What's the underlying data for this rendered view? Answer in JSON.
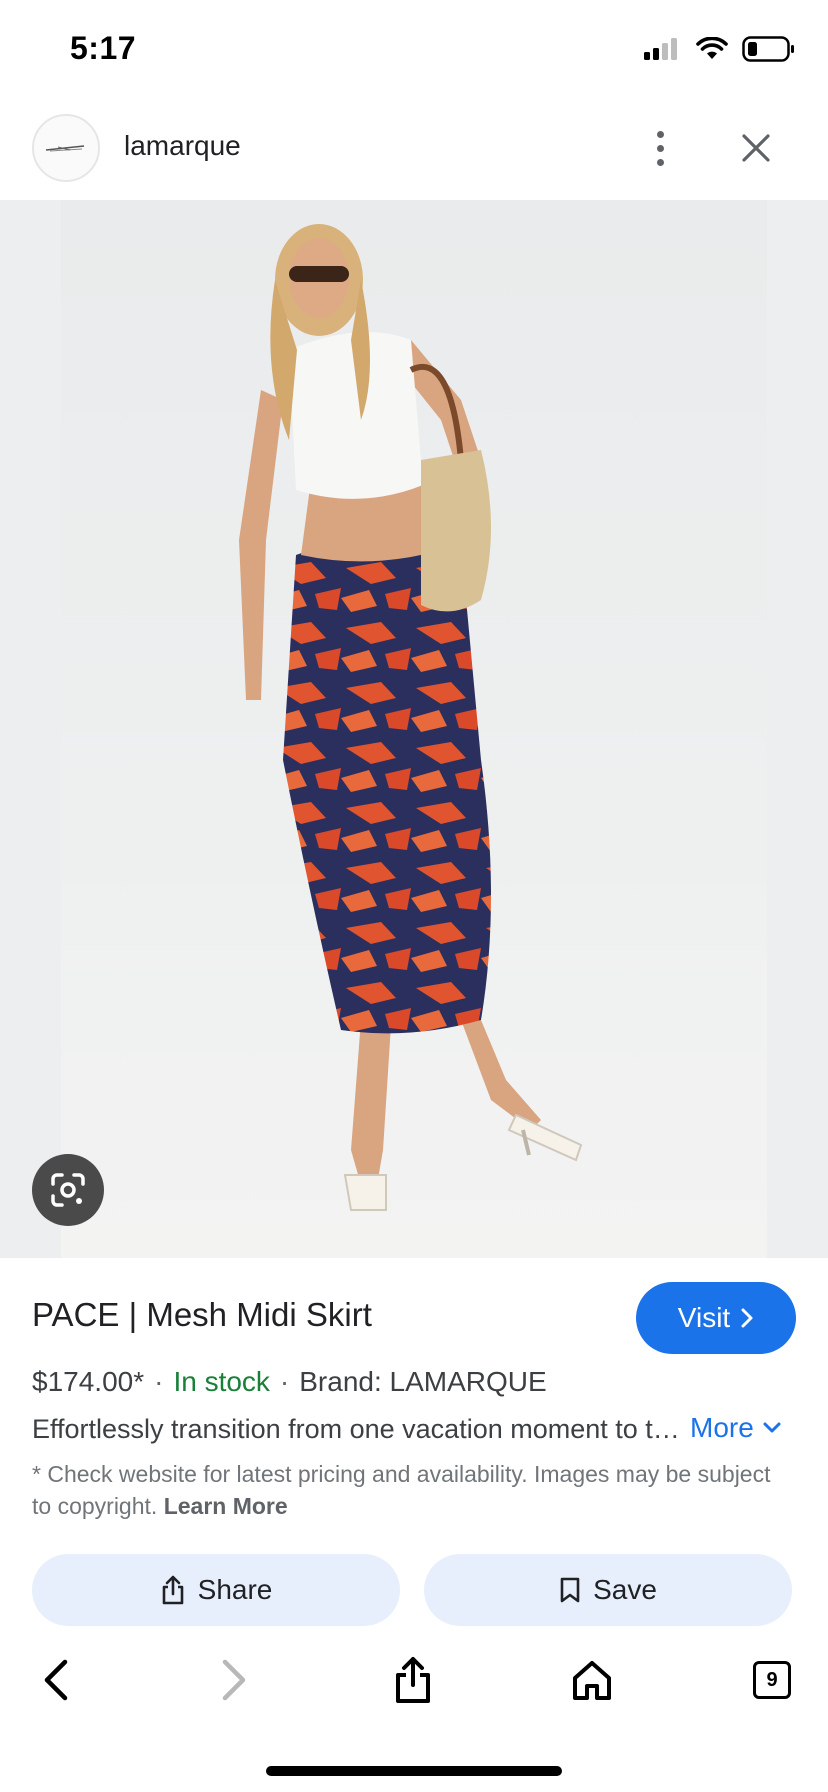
{
  "status_bar": {
    "time": "5:17",
    "icons": [
      "cellular-signal-icon",
      "wifi-icon",
      "battery-icon"
    ]
  },
  "header": {
    "site_name": "lamarque",
    "icons": [
      "site-logo-icon",
      "more-vert-icon",
      "close-icon"
    ]
  },
  "image": {
    "lens_icon": "google-lens-icon"
  },
  "product": {
    "title": "PACE | Mesh Midi Skirt",
    "price": "$174.00*",
    "separator": "·",
    "stock": "In stock",
    "brand": "Brand: LAMARQUE",
    "description": "Effortlessly transition from one vacation moment to the next",
    "more_label": "More",
    "disclaimer": "* Check website for latest pricing and availability. Images may be subject to copyright.",
    "learn_more": "Learn More",
    "visit_label": "Visit"
  },
  "actions": {
    "share_label": "Share",
    "save_label": "Save"
  },
  "browser_bar": {
    "tab_count": "9",
    "icons": [
      "back-icon",
      "forward-icon",
      "share-icon",
      "home-icon",
      "tabs-icon"
    ]
  },
  "colors": {
    "accent": "#1a73e8",
    "in_stock": "#188038",
    "action_bg": "#e8effc"
  }
}
